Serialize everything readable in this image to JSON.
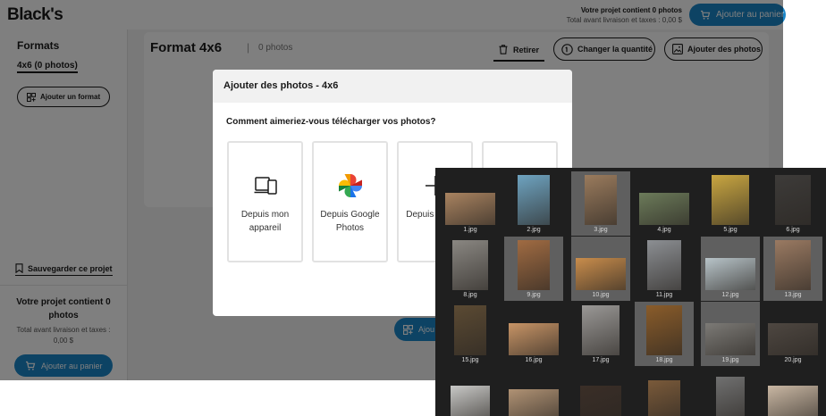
{
  "header": {
    "logo": "Black's",
    "project_title": "Votre projet contient 0 photos",
    "project_sub": "Total avant livraison et taxes : 0,00 $",
    "cart_button": "Ajouter au panier"
  },
  "sidebar": {
    "title": "Formats",
    "format_item": "4x6 (0 photos)",
    "add_format_button": "Ajouter un format",
    "save_project": "Sauvegarder ce projet",
    "project_title": "Votre projet contient 0 photos",
    "project_sub": "Total avant livraison et taxes : 0,00 $",
    "cart_button": "Ajouter au panier"
  },
  "main": {
    "format_title": "Format 4x6",
    "separator": "|",
    "photo_count": "0 photos",
    "remove_button": "Retirer",
    "quantity_button": "Changer la quantité",
    "add_photos_button": "Ajouter des photos",
    "center_button": "Ajou"
  },
  "modal": {
    "title": "Ajouter des photos - 4x6",
    "question": "Comment aimeriez-vous télécharger vos photos?",
    "options": [
      {
        "label": "Depuis mon appareil",
        "icon": "devices-icon"
      },
      {
        "label": "Depuis Google Photos",
        "icon": "google-photos-icon"
      },
      {
        "label": "Depuis réseau",
        "icon": "add-icon"
      },
      {
        "label": "",
        "icon": ""
      }
    ]
  },
  "file_browser": {
    "files": [
      {
        "name": "1.jpg",
        "selected": false,
        "color": "#a98360"
      },
      {
        "name": "2.jpg",
        "selected": false,
        "color": "#6ea3c0"
      },
      {
        "name": "3.jpg",
        "selected": true,
        "color": "#9a7b5d"
      },
      {
        "name": "4.jpg",
        "selected": false,
        "color": "#6c7b5a"
      },
      {
        "name": "5.jpg",
        "selected": false,
        "color": "#c9a641"
      },
      {
        "name": "6.jpg",
        "selected": false,
        "color": "#3d3b39"
      },
      {
        "name": "8.jpg",
        "selected": false,
        "color": "#8a8782"
      },
      {
        "name": "9.jpg",
        "selected": true,
        "color": "#a06b42"
      },
      {
        "name": "10.jpg",
        "selected": true,
        "color": "#c98d4c"
      },
      {
        "name": "11.jpg",
        "selected": false,
        "color": "#8c8f93"
      },
      {
        "name": "12.jpg",
        "selected": true,
        "color": "#b8c4c9"
      },
      {
        "name": "13.jpg",
        "selected": true,
        "color": "#9a7a62"
      },
      {
        "name": "15.jpg",
        "selected": false,
        "color": "#5b4a33"
      },
      {
        "name": "16.jpg",
        "selected": false,
        "color": "#c79466"
      },
      {
        "name": "17.jpg",
        "selected": false,
        "color": "#9a9896"
      },
      {
        "name": "18.jpg",
        "selected": true,
        "color": "#8a5c2a"
      },
      {
        "name": "19.jpg",
        "selected": true,
        "color": "#7c7a76"
      },
      {
        "name": "20.jpg",
        "selected": false,
        "color": "#4e4741"
      },
      {
        "name": "",
        "selected": false,
        "color": "#c8c8c6"
      },
      {
        "name": "",
        "selected": false,
        "color": "#b09274"
      },
      {
        "name": "",
        "selected": false,
        "color": "#3a2e27"
      },
      {
        "name": "",
        "selected": false,
        "color": "#7a5a3a"
      },
      {
        "name": "",
        "selected": false,
        "color": "#707070"
      },
      {
        "name": "",
        "selected": false,
        "color": "#c9b7a3"
      }
    ]
  },
  "colors": {
    "accent": "#1a86c9",
    "overlay": "#000000",
    "finder_bg": "#1f1f1f",
    "finder_selected": "#5f5f5f"
  }
}
